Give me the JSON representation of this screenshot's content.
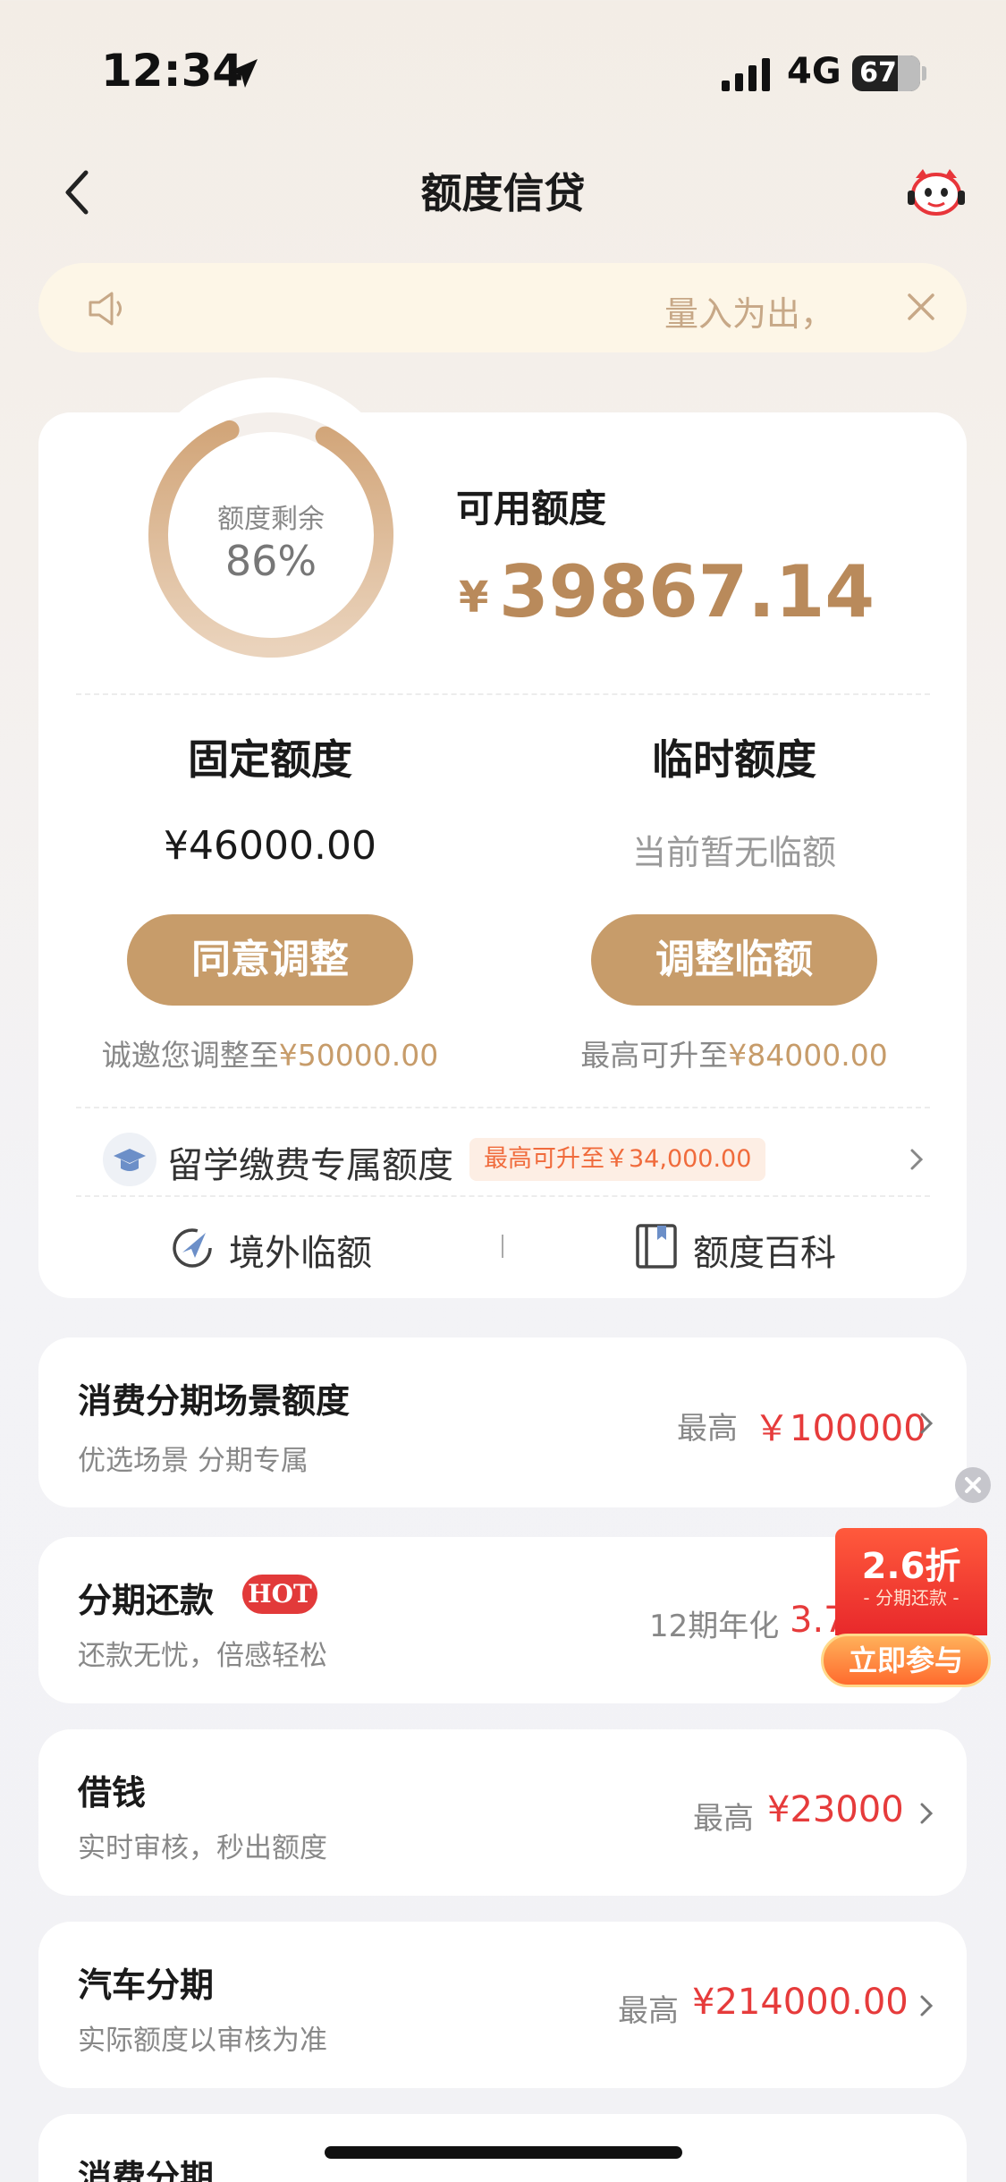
{
  "status_bar": {
    "time": "12:34",
    "network": "4G",
    "battery": "67"
  },
  "nav": {
    "title": "额度信贷"
  },
  "notice": {
    "text": "量入为出，"
  },
  "credit": {
    "gauge_label": "额度剩余",
    "gauge_percent_text": "86%",
    "gauge_fraction": 0.86,
    "available_label": "可用额度",
    "currency_symbol": "¥",
    "available_amount": "39867.14",
    "fixed": {
      "title": "固定额度",
      "value": "¥46000.00",
      "button": "同意调整",
      "hint_prefix": "诚邀您调整至",
      "hint_amount": "¥50000.00"
    },
    "temporary": {
      "title": "临时额度",
      "value": "当前暂无临额",
      "button": "调整临额",
      "hint_prefix": "最高可升至",
      "hint_amount": "¥84000.00"
    },
    "study": {
      "label": "留学缴费专属额度",
      "badge": "最高可升至￥34,000.00"
    },
    "links": [
      {
        "label": "境外临额",
        "icon": "plane-icon"
      },
      {
        "label": "额度百科",
        "icon": "book-icon"
      }
    ]
  },
  "features": [
    {
      "title": "消费分期场景额度",
      "subtitle": "优选场景 分期专属",
      "right_label": "最高",
      "right_value": "￥100000"
    },
    {
      "title": "分期还款",
      "badge": "HOT",
      "subtitle": "还款无忧，倍感轻松",
      "right_label": "12期年化",
      "right_value": "3.7"
    },
    {
      "title": "借钱",
      "subtitle": "实时审核，秒出额度",
      "right_label": "最高",
      "right_value": "¥23000"
    },
    {
      "title": "汽车分期",
      "subtitle": "实际额度以审核为准",
      "right_label": "最高",
      "right_value": "¥214000.00"
    },
    {
      "title": "消费分期"
    }
  ],
  "promo": {
    "discount": "2.6折",
    "subtitle": "- 分期还款 -",
    "cta": "立即参与"
  },
  "colors": {
    "gold": "#c79c6a",
    "amount_gold": "#b98a5b",
    "red": "#e63b3b",
    "page_bg": "#f3f0ec"
  }
}
